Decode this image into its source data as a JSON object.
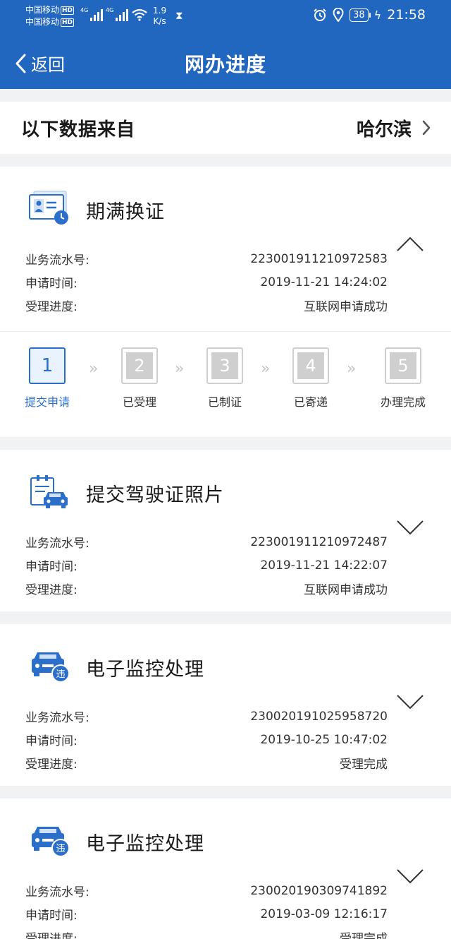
{
  "status_bar": {
    "carrier1": "中国移动",
    "carrier2": "中国移动",
    "hd": "HD",
    "net_type": "4G",
    "speed_value": "1.9",
    "speed_unit": "K/s",
    "battery": "38",
    "time": "21:58"
  },
  "nav": {
    "back_label": "返回",
    "title": "网办进度"
  },
  "source": {
    "label": "以下数据来自",
    "city": "哈尔滨"
  },
  "field_labels": {
    "serial": "业务流水号:",
    "time": "申请时间:",
    "progress": "受理进度:"
  },
  "cards": [
    {
      "title": "期满换证",
      "icon": "id-card-icon",
      "serial": "223001911210972583",
      "time": "2019-11-21 14:24:02",
      "progress": "互联网申请成功",
      "expanded": true
    },
    {
      "title": "提交驾驶证照片",
      "icon": "document-car-icon",
      "serial": "223001911210972487",
      "time": "2019-11-21 14:22:07",
      "progress": "互联网申请成功",
      "expanded": false
    },
    {
      "title": "电子监控处理",
      "icon": "car-violation-icon",
      "serial": "230020191025958720",
      "time": "2019-10-25 10:47:02",
      "progress": "受理完成",
      "expanded": false
    },
    {
      "title": "电子监控处理",
      "icon": "car-violation-icon",
      "serial": "230020190309741892",
      "time": "2019-03-09 12:16:17",
      "progress": "受理完成",
      "expanded": false
    }
  ],
  "steps": [
    {
      "num": "1",
      "label": "提交申请",
      "active": true
    },
    {
      "num": "2",
      "label": "已受理",
      "active": false
    },
    {
      "num": "3",
      "label": "已制证",
      "active": false
    },
    {
      "num": "4",
      "label": "已寄递",
      "active": false
    },
    {
      "num": "5",
      "label": "办理完成",
      "active": false
    }
  ],
  "violation_badge": "违",
  "colors": {
    "primary": "#2167c0",
    "accent": "#2c6fca",
    "inactive": "#cfcfcf"
  }
}
